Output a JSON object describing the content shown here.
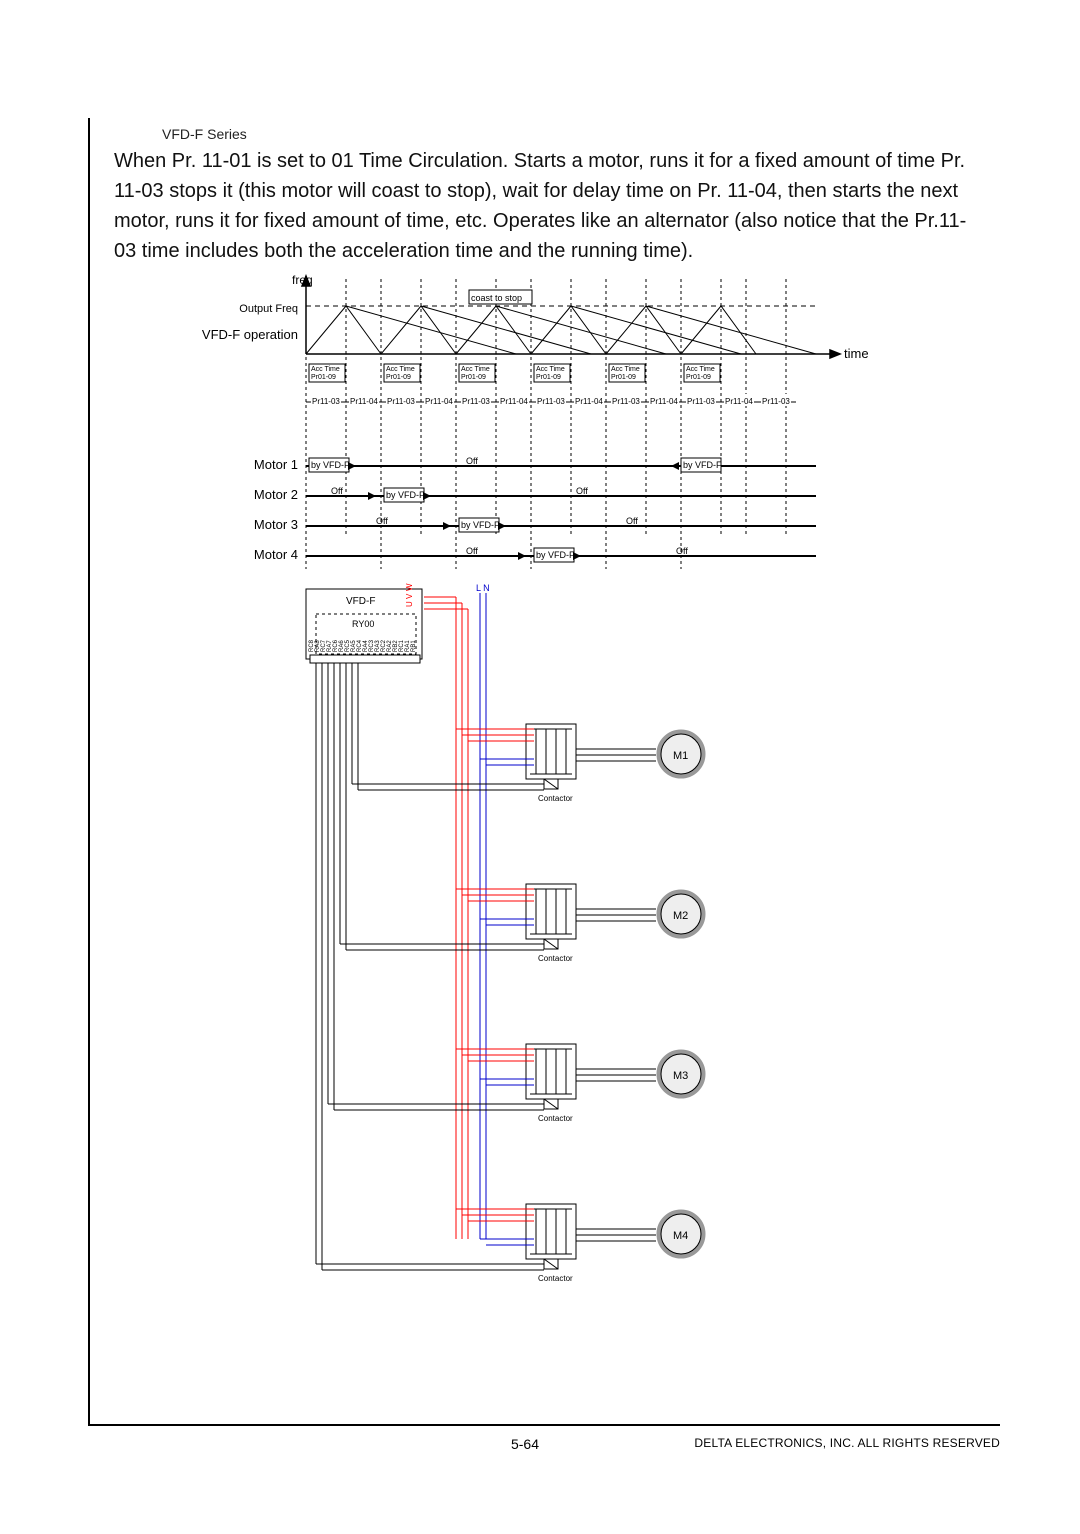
{
  "header": {
    "series": "VFD-F Series"
  },
  "paragraph": "When Pr. 11-01 is set to 01 Time Circulation. Starts a motor, runs it for a fixed amount of time Pr. 11-03 stops it (this motor will coast to stop), wait for delay time on Pr. 11-04, then starts the next motor, runs it for fixed amount of time, etc. Operates like an alternator (also notice that the Pr.11-03 time includes both the acceleration time and the running time).",
  "timing": {
    "yaxis": "freq",
    "output_freq": "Output Freq",
    "vfd_op": "VFD-F operation",
    "time": "time",
    "coast": "coast to stop",
    "acc": "Acc Time\nPr01-09",
    "p1103": "Pr11-03",
    "p1104": "Pr11-04",
    "motors": [
      "Motor 1",
      "Motor 2",
      "Motor 3",
      "Motor 4"
    ],
    "by": "by VFD-F",
    "off": "Off"
  },
  "wiring": {
    "drive": "VFD-F",
    "relay": "RY00",
    "uvw": [
      "U",
      "V",
      "W"
    ],
    "ln": "L N",
    "terminals": [
      "RC8",
      "RA8",
      "RC7",
      "RA7",
      "RC6",
      "RA6",
      "RC5",
      "RA5",
      "RC4",
      "RA4",
      "RC3",
      "RA3",
      "RC2",
      "RA2",
      "RB2",
      "RC1",
      "RA1",
      "RB1"
    ],
    "contactor": "Contactor",
    "motors": [
      "M1",
      "M2",
      "M3",
      "M4"
    ]
  },
  "footer": {
    "page": "5-64",
    "copyright": "DELTA ELECTRONICS, INC. ALL RIGHTS RESERVED"
  }
}
